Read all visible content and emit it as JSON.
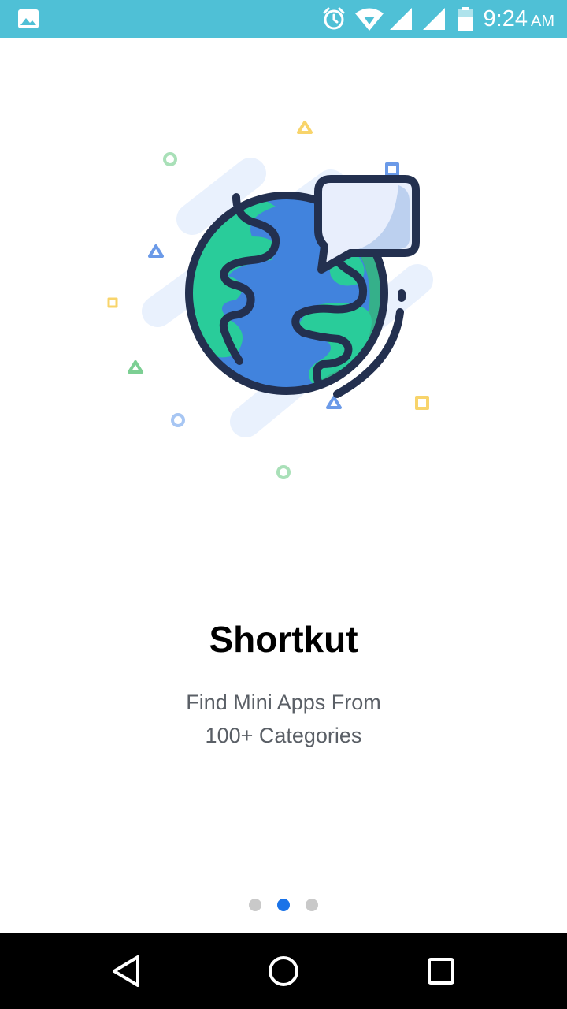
{
  "status_bar": {
    "time": "9:24",
    "ampm": "AM",
    "background_color": "#4fc0d6",
    "icons": [
      "image-icon",
      "alarm-icon",
      "wifi-icon",
      "signal-icon",
      "signal-icon",
      "battery-icon"
    ]
  },
  "onboarding": {
    "illustration": "globe-chat-icon",
    "title": "Shortkut",
    "subtitle_line1": "Find Mini Apps From",
    "subtitle_line2": "100+ Categories",
    "pages_total": 3,
    "current_page": 2,
    "indicator_active_color": "#1a73e8",
    "indicator_inactive_color": "#c9c9c9"
  },
  "nav_bar": {
    "buttons": [
      "back-icon",
      "home-icon",
      "recents-icon"
    ]
  }
}
